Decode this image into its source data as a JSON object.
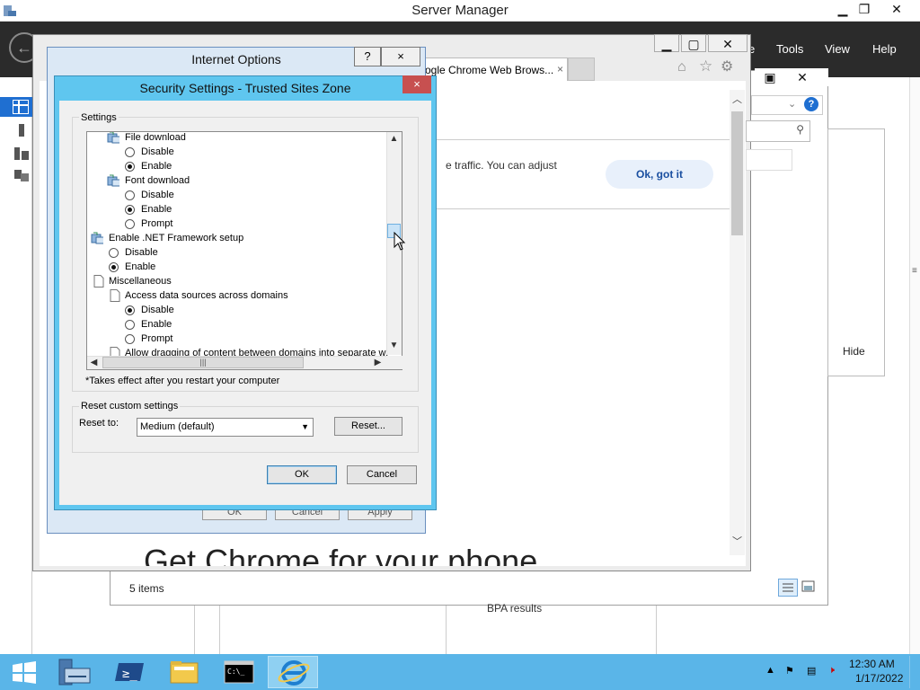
{
  "server_manager": {
    "title": "Server Manager",
    "menu": [
      "e",
      "Tools",
      "View",
      "Help"
    ],
    "items_count": "5 items",
    "hide_label": "Hide",
    "bpa_label": "BPA results"
  },
  "chrome": {
    "tab_title": "ogle Chrome Web Brows...",
    "tab_close": "×",
    "banner_text": "e traffic. You can adjust",
    "ok_button": "Ok, got it",
    "headline": "Get Chrome for your phone"
  },
  "internet_options": {
    "title": "Internet Options",
    "help_btn": "?",
    "close_btn": "×",
    "bottom_buttons": [
      "OK",
      "Cancel",
      "Apply"
    ]
  },
  "security_settings": {
    "title": "Security Settings - Trusted Sites Zone",
    "close_btn": "×",
    "settings_label": "Settings",
    "tree": [
      {
        "type": "group",
        "level": 1,
        "label": "File download"
      },
      {
        "type": "radio",
        "level": 2,
        "label": "Disable",
        "checked": false
      },
      {
        "type": "radio",
        "level": 2,
        "label": "Enable",
        "checked": true
      },
      {
        "type": "group",
        "level": 1,
        "label": "Font download"
      },
      {
        "type": "radio",
        "level": 2,
        "label": "Disable",
        "checked": false
      },
      {
        "type": "radio",
        "level": 2,
        "label": "Enable",
        "checked": true
      },
      {
        "type": "radio",
        "level": 2,
        "label": "Prompt",
        "checked": false
      },
      {
        "type": "group",
        "level": 0,
        "label": "Enable .NET Framework setup"
      },
      {
        "type": "radio",
        "level": 1,
        "label": "Disable",
        "checked": false
      },
      {
        "type": "radio",
        "level": 1,
        "label": "Enable",
        "checked": true
      },
      {
        "type": "page",
        "level": 0,
        "label": "Miscellaneous"
      },
      {
        "type": "page",
        "level": 1,
        "label": "Access data sources across domains"
      },
      {
        "type": "radio",
        "level": 2,
        "label": "Disable",
        "checked": true
      },
      {
        "type": "radio",
        "level": 2,
        "label": "Enable",
        "checked": false
      },
      {
        "type": "radio",
        "level": 2,
        "label": "Prompt",
        "checked": false
      },
      {
        "type": "page",
        "level": 1,
        "label": "Allow dragging of content between domains into separate wi"
      }
    ],
    "restart_note": "*Takes effect after you restart your computer",
    "reset_group_label": "Reset custom settings",
    "reset_to_label": "Reset to:",
    "reset_select_value": "Medium (default)",
    "reset_button": "Reset...",
    "ok_button": "OK",
    "cancel_button": "Cancel"
  },
  "taskbar": {
    "time": "12:30 AM",
    "date": "1/17/2022",
    "items": [
      "start",
      "server-manager",
      "powershell",
      "file-explorer",
      "command-prompt",
      "internet-explorer"
    ]
  },
  "colors": {
    "accent": "#5ab5e8",
    "dialog_border": "#5fc6ef",
    "close_red": "#c75050"
  }
}
